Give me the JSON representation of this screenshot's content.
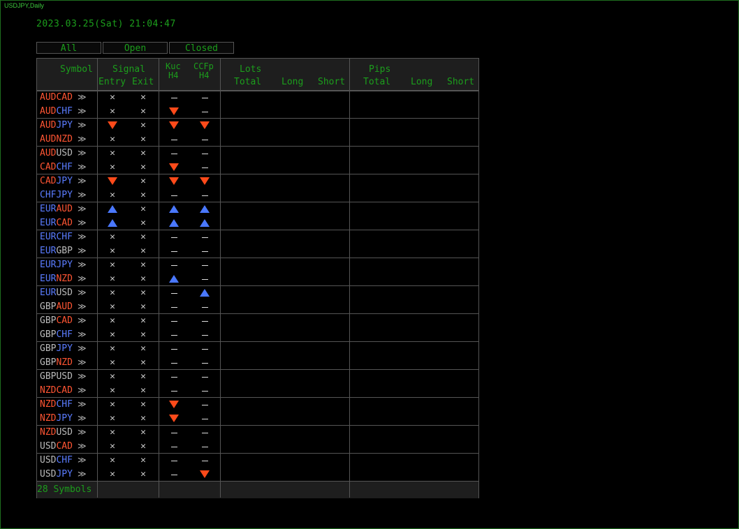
{
  "window": {
    "title": "USDJPY,Daily"
  },
  "datetime": "2023.03.25(Sat) 21:04:47",
  "tabs": [
    "All",
    "Open",
    "Closed"
  ],
  "header": {
    "symbol": "Symbol",
    "signal": "Signal",
    "entry": "Entry",
    "exit": "Exit",
    "kuc": "Kuc",
    "kuc_tf": "H4",
    "ccfp": "CCFp",
    "ccfp_tf": "H4",
    "lots": "Lots",
    "lots_total": "Total",
    "lots_long": "Long",
    "lots_short": "Short",
    "pips": "Pips",
    "pips_total": "Total",
    "pips_long": "Long",
    "pips_short": "Short"
  },
  "colors": {
    "up": "#4a78ff",
    "down": "#ff4a1a",
    "neutral": "#bbbbbb",
    "text_green": "#1c9e1c"
  },
  "arrow_glyph": "≫",
  "rows": [
    {
      "base": "AUD",
      "quote": "CAD",
      "bc": "#ff5533",
      "qc": "#ff5533",
      "entry": "x",
      "exit": "x",
      "kuc": "-",
      "ccfp": "-"
    },
    {
      "base": "AUD",
      "quote": "CHF",
      "bc": "#ff5533",
      "qc": "#5a7cff",
      "entry": "x",
      "exit": "x",
      "kuc": "down",
      "ccfp": "-"
    },
    {
      "base": "AUD",
      "quote": "JPY",
      "bc": "#ff5533",
      "qc": "#5a7cff",
      "entry": "down",
      "exit": "x",
      "kuc": "down",
      "ccfp": "down"
    },
    {
      "base": "AUD",
      "quote": "NZD",
      "bc": "#ff5533",
      "qc": "#ff5533",
      "entry": "x",
      "exit": "x",
      "kuc": "-",
      "ccfp": "-"
    },
    {
      "base": "AUD",
      "quote": "USD",
      "bc": "#ff5533",
      "qc": "#bbbbbb",
      "entry": "x",
      "exit": "x",
      "kuc": "-",
      "ccfp": "-"
    },
    {
      "base": "CAD",
      "quote": "CHF",
      "bc": "#ff5533",
      "qc": "#5a7cff",
      "entry": "x",
      "exit": "x",
      "kuc": "down",
      "ccfp": "-"
    },
    {
      "base": "CAD",
      "quote": "JPY",
      "bc": "#ff5533",
      "qc": "#5a7cff",
      "entry": "down",
      "exit": "x",
      "kuc": "down",
      "ccfp": "down"
    },
    {
      "base": "CHF",
      "quote": "JPY",
      "bc": "#5a7cff",
      "qc": "#5a7cff",
      "entry": "x",
      "exit": "x",
      "kuc": "-",
      "ccfp": "-"
    },
    {
      "base": "EUR",
      "quote": "AUD",
      "bc": "#5a7cff",
      "qc": "#ff5533",
      "entry": "up",
      "exit": "x",
      "kuc": "up",
      "ccfp": "up"
    },
    {
      "base": "EUR",
      "quote": "CAD",
      "bc": "#5a7cff",
      "qc": "#ff5533",
      "entry": "up",
      "exit": "x",
      "kuc": "up",
      "ccfp": "up"
    },
    {
      "base": "EUR",
      "quote": "CHF",
      "bc": "#5a7cff",
      "qc": "#5a7cff",
      "entry": "x",
      "exit": "x",
      "kuc": "-",
      "ccfp": "-"
    },
    {
      "base": "EUR",
      "quote": "GBP",
      "bc": "#5a7cff",
      "qc": "#bbbbbb",
      "entry": "x",
      "exit": "x",
      "kuc": "-",
      "ccfp": "-"
    },
    {
      "base": "EUR",
      "quote": "JPY",
      "bc": "#5a7cff",
      "qc": "#5a7cff",
      "entry": "x",
      "exit": "x",
      "kuc": "-",
      "ccfp": "-"
    },
    {
      "base": "EUR",
      "quote": "NZD",
      "bc": "#5a7cff",
      "qc": "#ff5533",
      "entry": "x",
      "exit": "x",
      "kuc": "up",
      "ccfp": "-"
    },
    {
      "base": "EUR",
      "quote": "USD",
      "bc": "#5a7cff",
      "qc": "#bbbbbb",
      "entry": "x",
      "exit": "x",
      "kuc": "-",
      "ccfp": "up"
    },
    {
      "base": "GBP",
      "quote": "AUD",
      "bc": "#bbbbbb",
      "qc": "#ff5533",
      "entry": "x",
      "exit": "x",
      "kuc": "-",
      "ccfp": "-"
    },
    {
      "base": "GBP",
      "quote": "CAD",
      "bc": "#bbbbbb",
      "qc": "#ff5533",
      "entry": "x",
      "exit": "x",
      "kuc": "-",
      "ccfp": "-"
    },
    {
      "base": "GBP",
      "quote": "CHF",
      "bc": "#bbbbbb",
      "qc": "#5a7cff",
      "entry": "x",
      "exit": "x",
      "kuc": "-",
      "ccfp": "-"
    },
    {
      "base": "GBP",
      "quote": "JPY",
      "bc": "#bbbbbb",
      "qc": "#5a7cff",
      "entry": "x",
      "exit": "x",
      "kuc": "-",
      "ccfp": "-"
    },
    {
      "base": "GBP",
      "quote": "NZD",
      "bc": "#bbbbbb",
      "qc": "#ff5533",
      "entry": "x",
      "exit": "x",
      "kuc": "-",
      "ccfp": "-"
    },
    {
      "base": "GBP",
      "quote": "USD",
      "bc": "#bbbbbb",
      "qc": "#bbbbbb",
      "entry": "x",
      "exit": "x",
      "kuc": "-",
      "ccfp": "-"
    },
    {
      "base": "NZD",
      "quote": "CAD",
      "bc": "#ff5533",
      "qc": "#ff5533",
      "entry": "x",
      "exit": "x",
      "kuc": "-",
      "ccfp": "-"
    },
    {
      "base": "NZD",
      "quote": "CHF",
      "bc": "#ff5533",
      "qc": "#5a7cff",
      "entry": "x",
      "exit": "x",
      "kuc": "down",
      "ccfp": "-"
    },
    {
      "base": "NZD",
      "quote": "JPY",
      "bc": "#ff5533",
      "qc": "#5a7cff",
      "entry": "x",
      "exit": "x",
      "kuc": "down",
      "ccfp": "-"
    },
    {
      "base": "NZD",
      "quote": "USD",
      "bc": "#ff5533",
      "qc": "#bbbbbb",
      "entry": "x",
      "exit": "x",
      "kuc": "-",
      "ccfp": "-"
    },
    {
      "base": "USD",
      "quote": "CAD",
      "bc": "#bbbbbb",
      "qc": "#ff5533",
      "entry": "x",
      "exit": "x",
      "kuc": "-",
      "ccfp": "-"
    },
    {
      "base": "USD",
      "quote": "CHF",
      "bc": "#bbbbbb",
      "qc": "#5a7cff",
      "entry": "x",
      "exit": "x",
      "kuc": "-",
      "ccfp": "-"
    },
    {
      "base": "USD",
      "quote": "JPY",
      "bc": "#bbbbbb",
      "qc": "#5a7cff",
      "entry": "x",
      "exit": "x",
      "kuc": "-",
      "ccfp": "down"
    }
  ],
  "footer": {
    "count": "28 Symbols"
  }
}
